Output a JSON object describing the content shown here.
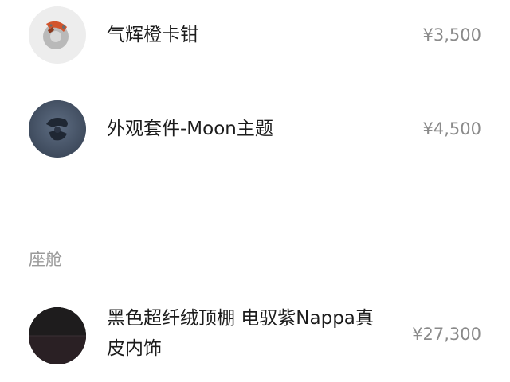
{
  "items": [
    {
      "name": "气辉橙卡钳",
      "price": "¥3,500",
      "icon": "brake-caliper-icon"
    },
    {
      "name": "外观套件-Moon主题",
      "price": "¥4,500",
      "icon": "moon-wheel-icon"
    }
  ],
  "cabin": {
    "title": "座舱",
    "items": [
      {
        "name_line1": "黑色超纤绒顶棚 电驭紫Nappa真",
        "name_line2": "皮内饰",
        "price": "¥27,300",
        "icon": "interior-swatch-icon"
      }
    ]
  }
}
